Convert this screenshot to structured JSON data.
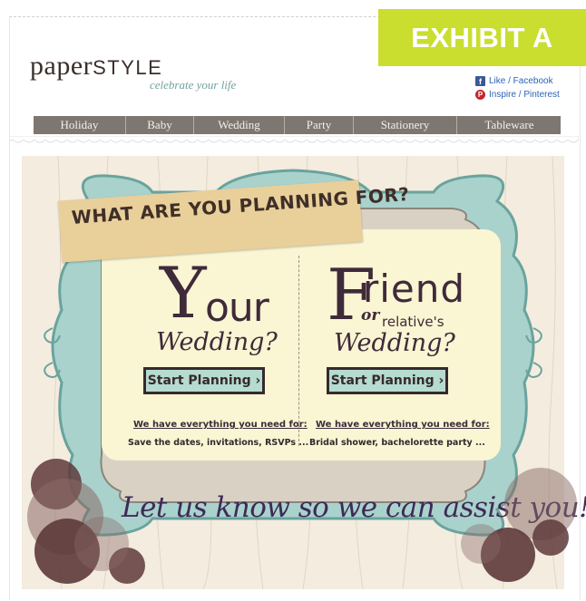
{
  "exhibit_label": "EXHIBIT A",
  "logo": {
    "main": "paper",
    "style": "STYLE",
    "tagline": "celebrate your life"
  },
  "social": [
    {
      "label": "Like / Facebook",
      "icon": "facebook-icon"
    },
    {
      "label": "Inspire / Pinterest",
      "icon": "pinterest-icon"
    }
  ],
  "nav": [
    "Holiday",
    "Baby",
    "Wedding",
    "Party",
    "Stationery",
    "Tableware"
  ],
  "banner": {
    "heading": "WHAT ARE YOU PLANNING FOR?",
    "left": {
      "big_letter": "Y",
      "rest": "our",
      "subtitle": "Wedding?",
      "button": "Start Planning ›",
      "need": "We have everything you need for:",
      "desc": "Save the dates, invitations, RSVPs ..."
    },
    "right": {
      "big_letter": "F",
      "rest": "riend",
      "or": "or",
      "relatives": "relative's",
      "subtitle": "Wedding?",
      "button": "Start Planning ›",
      "need": "We have everything you need for:",
      "desc": "Bridal shower, bachelorette party ..."
    },
    "cta": "Let us know so we can assist you!"
  },
  "colors": {
    "exhibit": "#c9de2e",
    "nav": "#7e7670",
    "frame": "#a9d2cd",
    "button": "#b6dbd0",
    "circles": "#6b3f3f"
  }
}
